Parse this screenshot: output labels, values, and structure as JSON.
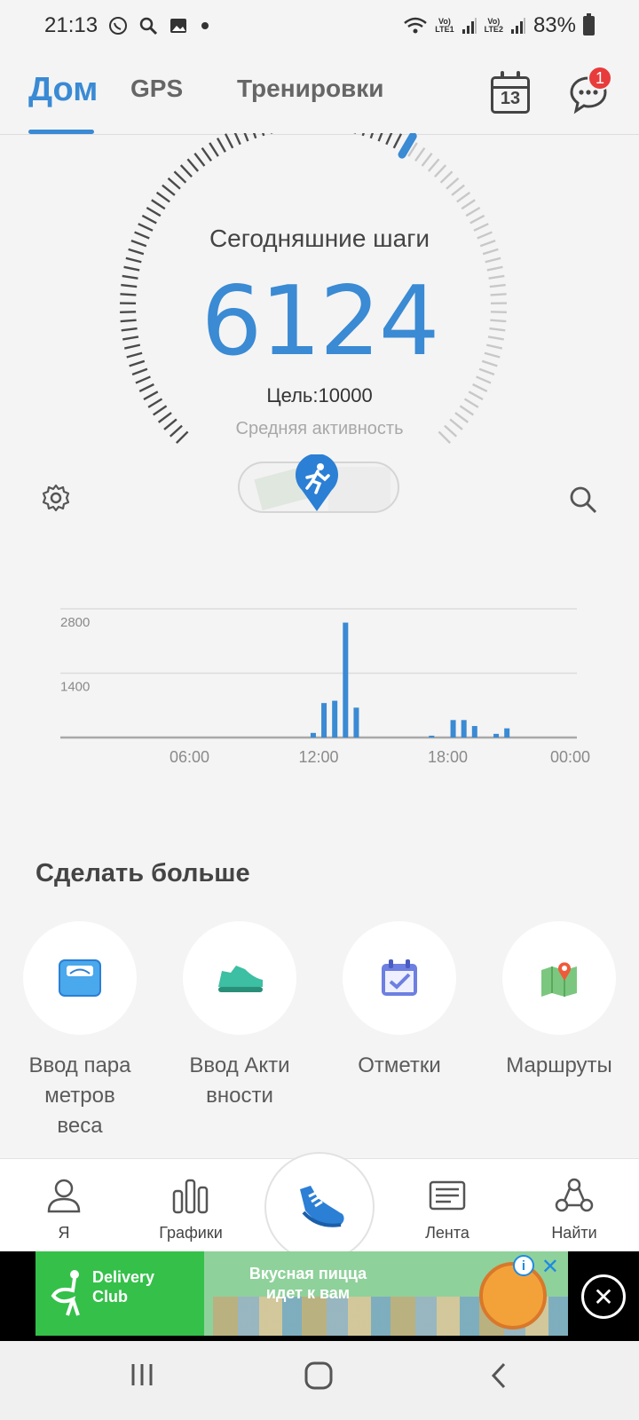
{
  "status_bar": {
    "time": "21:13",
    "lte1": "LTE1",
    "lte2": "LTE2",
    "volte": "Vo)",
    "battery": "83%",
    "icons": [
      "whatsapp-icon",
      "search-icon",
      "image-icon",
      "dot-icon",
      "wifi-icon",
      "signal-icon",
      "battery-icon"
    ]
  },
  "top_nav": {
    "tabs": [
      {
        "label": "Дом",
        "active": true
      },
      {
        "label": "GPS",
        "active": false
      },
      {
        "label": "Тренировки",
        "active": false
      }
    ],
    "calendar_day": "13",
    "notification_count": "1"
  },
  "steps": {
    "title": "Сегодняшние шаги",
    "value": "6124",
    "goal": "Цель:10000",
    "activity_level": "Средняя активность",
    "progress_fraction": 0.6124
  },
  "chart_data": {
    "type": "bar",
    "y_ticks": [
      "2800",
      "1400"
    ],
    "x_ticks": [
      "06:00",
      "12:00",
      "18:00",
      "00:00"
    ],
    "ylim": [
      0,
      2800
    ],
    "x_range_hours": [
      0,
      24
    ],
    "bars": [
      {
        "hour": 11.75,
        "value": 100
      },
      {
        "hour": 12.25,
        "value": 750
      },
      {
        "hour": 12.75,
        "value": 800
      },
      {
        "hour": 13.25,
        "value": 2500
      },
      {
        "hour": 13.75,
        "value": 650
      },
      {
        "hour": 17.25,
        "value": 40
      },
      {
        "hour": 18.25,
        "value": 380
      },
      {
        "hour": 18.75,
        "value": 380
      },
      {
        "hour": 19.25,
        "value": 250
      },
      {
        "hour": 20.25,
        "value": 80
      },
      {
        "hour": 20.75,
        "value": 200
      }
    ],
    "color": "#3a8ad4"
  },
  "more": {
    "title": "Сделать больше",
    "items": [
      {
        "label": "Ввод пара метров веса",
        "lines": [
          "Ввод пара",
          "метров",
          "веса"
        ],
        "icon": "scale-icon"
      },
      {
        "label": "Ввод Акти вности",
        "lines": [
          "Ввод Акти",
          "вности"
        ],
        "icon": "sneaker-icon"
      },
      {
        "label": "Отметки",
        "lines": [
          "Отметки"
        ],
        "icon": "calendar-check-icon"
      },
      {
        "label": "Маршруты",
        "lines": [
          "Маршруты"
        ],
        "icon": "map-pin-icon"
      }
    ]
  },
  "bottom_nav": {
    "me": "Я",
    "charts": "Графики",
    "feed": "Лента",
    "find": "Найти"
  },
  "ad": {
    "brand_line1": "Delivery",
    "brand_line2": "Club",
    "headline_line1": "Вкусная пицца",
    "headline_line2": "идет к вам"
  },
  "colors": {
    "accent": "#3a8ad4",
    "badge": "#e83b3b",
    "ad_green": "#35c04a"
  }
}
